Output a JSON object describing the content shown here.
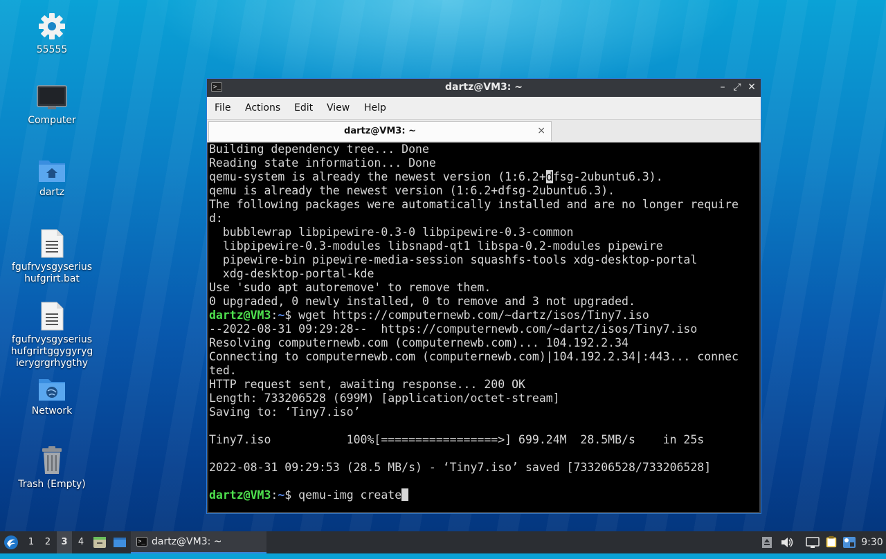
{
  "desktop": {
    "icons": [
      {
        "label": "55555",
        "icon": "gear-icon"
      },
      {
        "label": "Computer",
        "icon": "monitor-icon"
      },
      {
        "label": "dartz",
        "icon": "home-folder-icon"
      },
      {
        "label": "fgufrvysgyserius\nhufgrirt.bat",
        "icon": "text-file-icon"
      },
      {
        "label": "fgufrvysgyserius\nhufgrirtggygyryg\nierygrgrhygthy",
        "icon": "text-file-icon"
      },
      {
        "label": "Network",
        "icon": "network-folder-icon"
      },
      {
        "label": "Trash (Empty)",
        "icon": "trash-icon"
      }
    ]
  },
  "window": {
    "title": "dartz@VM3: ~",
    "menu": [
      "File",
      "Actions",
      "Edit",
      "View",
      "Help"
    ],
    "tab_label": "dartz@VM3: ~",
    "tab_close": "×",
    "controls": {
      "minimize": "–",
      "maximize": "⤢",
      "close": "✕"
    }
  },
  "terminal": {
    "lines": [
      "Building dependency tree... Done",
      "Reading state information... Done",
      "qemu-system is already the newest version (1:6.2+dfsg-2ubuntu6.3).",
      "qemu is already the newest version (1:6.2+dfsg-2ubuntu6.3).",
      "The following packages were automatically installed and are no longer require",
      "d:",
      "  bubblewrap libpipewire-0.3-0 libpipewire-0.3-common",
      "  libpipewire-0.3-modules libsnapd-qt1 libspa-0.2-modules pipewire",
      "  pipewire-bin pipewire-media-session squashfs-tools xdg-desktop-portal",
      "  xdg-desktop-portal-kde",
      "Use 'sudo apt autoremove' to remove them.",
      "0 upgraded, 0 newly installed, 0 to remove and 3 not upgraded.",
      "PROMPT1",
      "--2022-08-31 09:29:28--  https://computernewb.com/~dartz/isos/Tiny7.iso",
      "Resolving computernewb.com (computernewb.com)... 104.192.2.34",
      "Connecting to computernewb.com (computernewb.com)|104.192.2.34|:443... connec",
      "ted.",
      "HTTP request sent, awaiting response... 200 OK",
      "Length: 733206528 (699M) [application/octet-stream]",
      "Saving to: ‘Tiny7.iso’",
      "",
      "Tiny7.iso           100%[=================>] 699.24M  28.5MB/s    in 25s",
      "",
      "2022-08-31 09:29:53 (28.5 MB/s) - ‘Tiny7.iso’ saved [733206528/733206528]",
      "",
      "PROMPT2"
    ],
    "prompt_user": "dartz@VM3",
    "prompt_sep": ":",
    "prompt_path": "~",
    "prompt_dollar": "$",
    "cmd1": " wget https://computernewb.com/~dartz/isos/Tiny7.iso",
    "cmd2": " qemu-img create",
    "selection_highlight": {
      "line": 2,
      "char_index": 49
    }
  },
  "taskbar": {
    "workspaces": [
      "1",
      "2",
      "3",
      "4"
    ],
    "active_workspace": "3",
    "task_label": "dartz@VM3: ~",
    "clock": "9:30"
  },
  "colors": {
    "prompt_user": "#4ee04e",
    "prompt_path": "#5a8cf0",
    "window_border": "#2b7bd8",
    "taskbar": "#2b2e33"
  }
}
